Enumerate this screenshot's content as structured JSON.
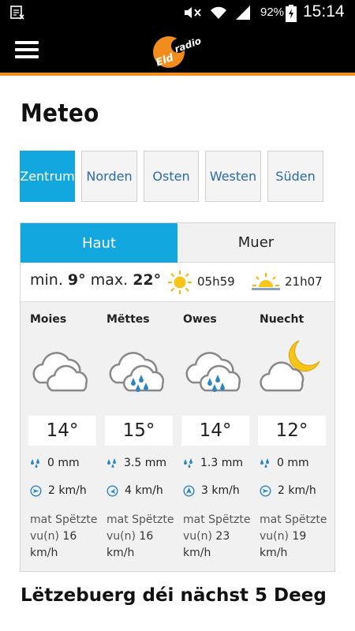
{
  "status_bar": {
    "battery": "92%",
    "time": "15:14"
  },
  "app": {
    "logo_text": "Eldoradio",
    "menu_icon": "hamburger-menu-icon"
  },
  "page_title": "Meteo",
  "regions": [
    "Zentrum",
    "Norden",
    "Osten",
    "Westen",
    "Süden"
  ],
  "active_region": "Zentrum",
  "toggle": {
    "today": "Haut",
    "tomorrow": "Muer",
    "active": "today"
  },
  "day": {
    "min_label": "min.",
    "min": "9°",
    "max_label": "max.",
    "max": "22°",
    "sunrise": "05h59",
    "sunset": "21h07"
  },
  "periods": [
    {
      "name": "Moies",
      "icon": "cloudy-icon",
      "temp": "14°",
      "rain": "0 mm",
      "wind": "2 km/h",
      "gust_label": "mat Spëtzte vu(n)",
      "gust": "16 km/h"
    },
    {
      "name": "Mëttes",
      "icon": "cloud-rain-icon",
      "temp": "15°",
      "rain": "3.5 mm",
      "wind": "4 km/h",
      "gust_label": "mat Spëtzte vu(n)",
      "gust": "16 km/h"
    },
    {
      "name": "Owes",
      "icon": "cloud-rain-icon",
      "temp": "14°",
      "rain": "1.3 mm",
      "wind": "3 km/h",
      "gust_label": "mat Spëtzte vu(n)",
      "gust": "23 km/h"
    },
    {
      "name": "Nuecht",
      "icon": "moon-cloud-icon",
      "temp": "12°",
      "rain": "0 mm",
      "wind": "2 km/h",
      "gust_label": "mat Spëtzte vu(n)",
      "gust": "19 km/h"
    }
  ],
  "section_title": "Lëtzebuerg déi nächst 5 Deeg",
  "colors": {
    "accent_blue": "#13a7e0",
    "brand_orange": "#f28c1c",
    "link_blue": "#2a6aa8"
  }
}
